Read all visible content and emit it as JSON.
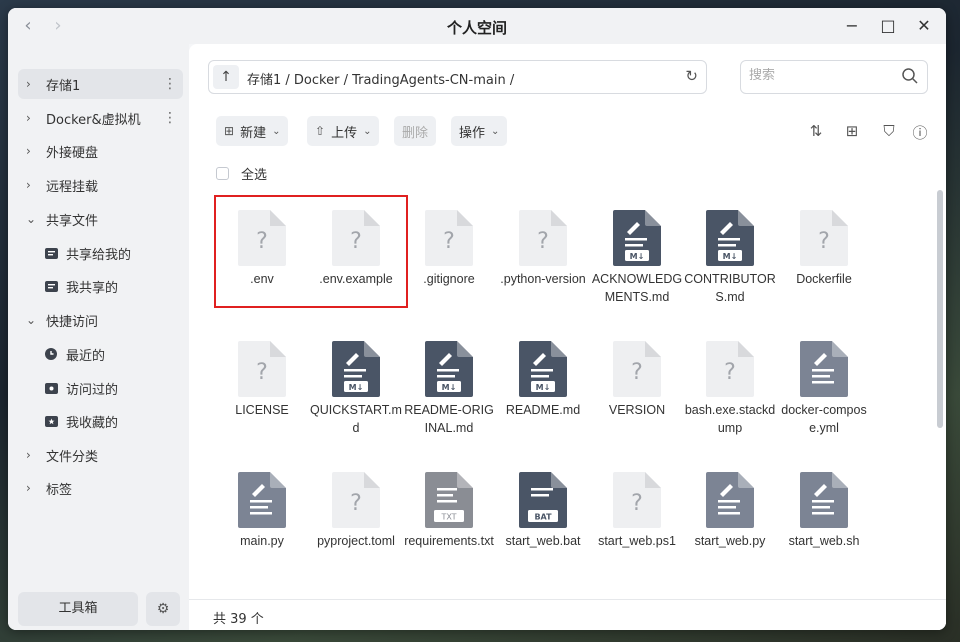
{
  "window": {
    "title": "个人空间",
    "back": "‹",
    "forward": "›",
    "minimize": "−",
    "maximize": "□",
    "close": "✕"
  },
  "sidebar": {
    "items": [
      {
        "label": "存储1",
        "has_more": true
      },
      {
        "label": "Docker&虚拟机",
        "has_more": true
      },
      {
        "label": "外接硬盘"
      },
      {
        "label": "远程挂载"
      },
      {
        "label": "共享文件",
        "expanded": true
      },
      {
        "label": "快捷访问",
        "expanded": true
      },
      {
        "label": "文件分类"
      },
      {
        "label": "标签"
      }
    ],
    "shared_children": [
      "共享给我的",
      "我共享的"
    ],
    "quick_children": [
      "最近的",
      "访问过的",
      "我收藏的"
    ],
    "tools_label": "工具箱"
  },
  "pathbar": {
    "path": "存储1 / Docker / TradingAgents-CN-main /"
  },
  "search": {
    "placeholder": "搜索"
  },
  "toolbar": {
    "new_label": "新建",
    "upload_label": "上传",
    "delete_label": "删除",
    "action_label": "操作"
  },
  "select_all_label": "全选",
  "files": [
    {
      "name": ".env",
      "icon": "unknown"
    },
    {
      "name": ".env.example",
      "icon": "unknown"
    },
    {
      "name": ".gitignore",
      "icon": "unknown"
    },
    {
      "name": ".python-version",
      "icon": "unknown"
    },
    {
      "name": "ACKNOWLEDGMENTS.md",
      "icon": "md"
    },
    {
      "name": "CONTRIBUTORS.md",
      "icon": "md"
    },
    {
      "name": "Dockerfile",
      "icon": "unknown"
    },
    {
      "name": "LICENSE",
      "icon": "unknown"
    },
    {
      "name": "QUICKSTART.md",
      "icon": "md"
    },
    {
      "name": "README-ORIGINAL.md",
      "icon": "md"
    },
    {
      "name": "README.md",
      "icon": "md"
    },
    {
      "name": "VERSION",
      "icon": "unknown"
    },
    {
      "name": "bash.exe.stackdump",
      "icon": "unknown"
    },
    {
      "name": "docker-compose.yml",
      "icon": "doc"
    },
    {
      "name": "main.py",
      "icon": "doc"
    },
    {
      "name": "pyproject.toml",
      "icon": "unknown"
    },
    {
      "name": "requirements.txt",
      "icon": "txt"
    },
    {
      "name": "start_web.bat",
      "icon": "bat"
    },
    {
      "name": "start_web.ps1",
      "icon": "unknown"
    },
    {
      "name": "start_web.py",
      "icon": "doc"
    },
    {
      "name": "start_web.sh",
      "icon": "doc"
    }
  ],
  "footer": {
    "count_label": "共 39 个"
  },
  "colors": {
    "highlight": "#e02020",
    "md_icon": "#4a5566",
    "doc_icon": "#7c8494",
    "txt_icon": "#8a8d94"
  }
}
